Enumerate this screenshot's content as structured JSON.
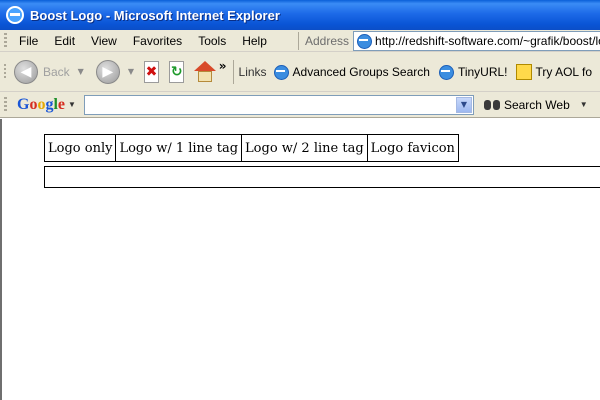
{
  "window": {
    "title": "Boost Logo - Microsoft Internet Explorer"
  },
  "menu": {
    "items": [
      "File",
      "Edit",
      "View",
      "Favorites",
      "Tools",
      "Help"
    ],
    "address_label": "Address",
    "address_value": "http://redshift-software.com/~grafik/boost/log"
  },
  "toolbar": {
    "back_label": "Back",
    "more_glyph": "»",
    "links_label": "Links",
    "links": [
      "Advanced Groups Search",
      "TinyURL!",
      "Try AOL fo"
    ]
  },
  "googlebar": {
    "logo": [
      "G",
      "o",
      "o",
      "g",
      "l",
      "e"
    ],
    "search_value": "",
    "search_button": "Search Web"
  },
  "content": {
    "tabs": [
      "Logo only",
      "Logo w/ 1 line tag",
      "Logo w/ 2 line tag",
      "Logo favicon"
    ]
  },
  "colors": {
    "titlebar": "#0a55d6",
    "chrome": "#ece9d8",
    "page_background": "#ffffff"
  }
}
